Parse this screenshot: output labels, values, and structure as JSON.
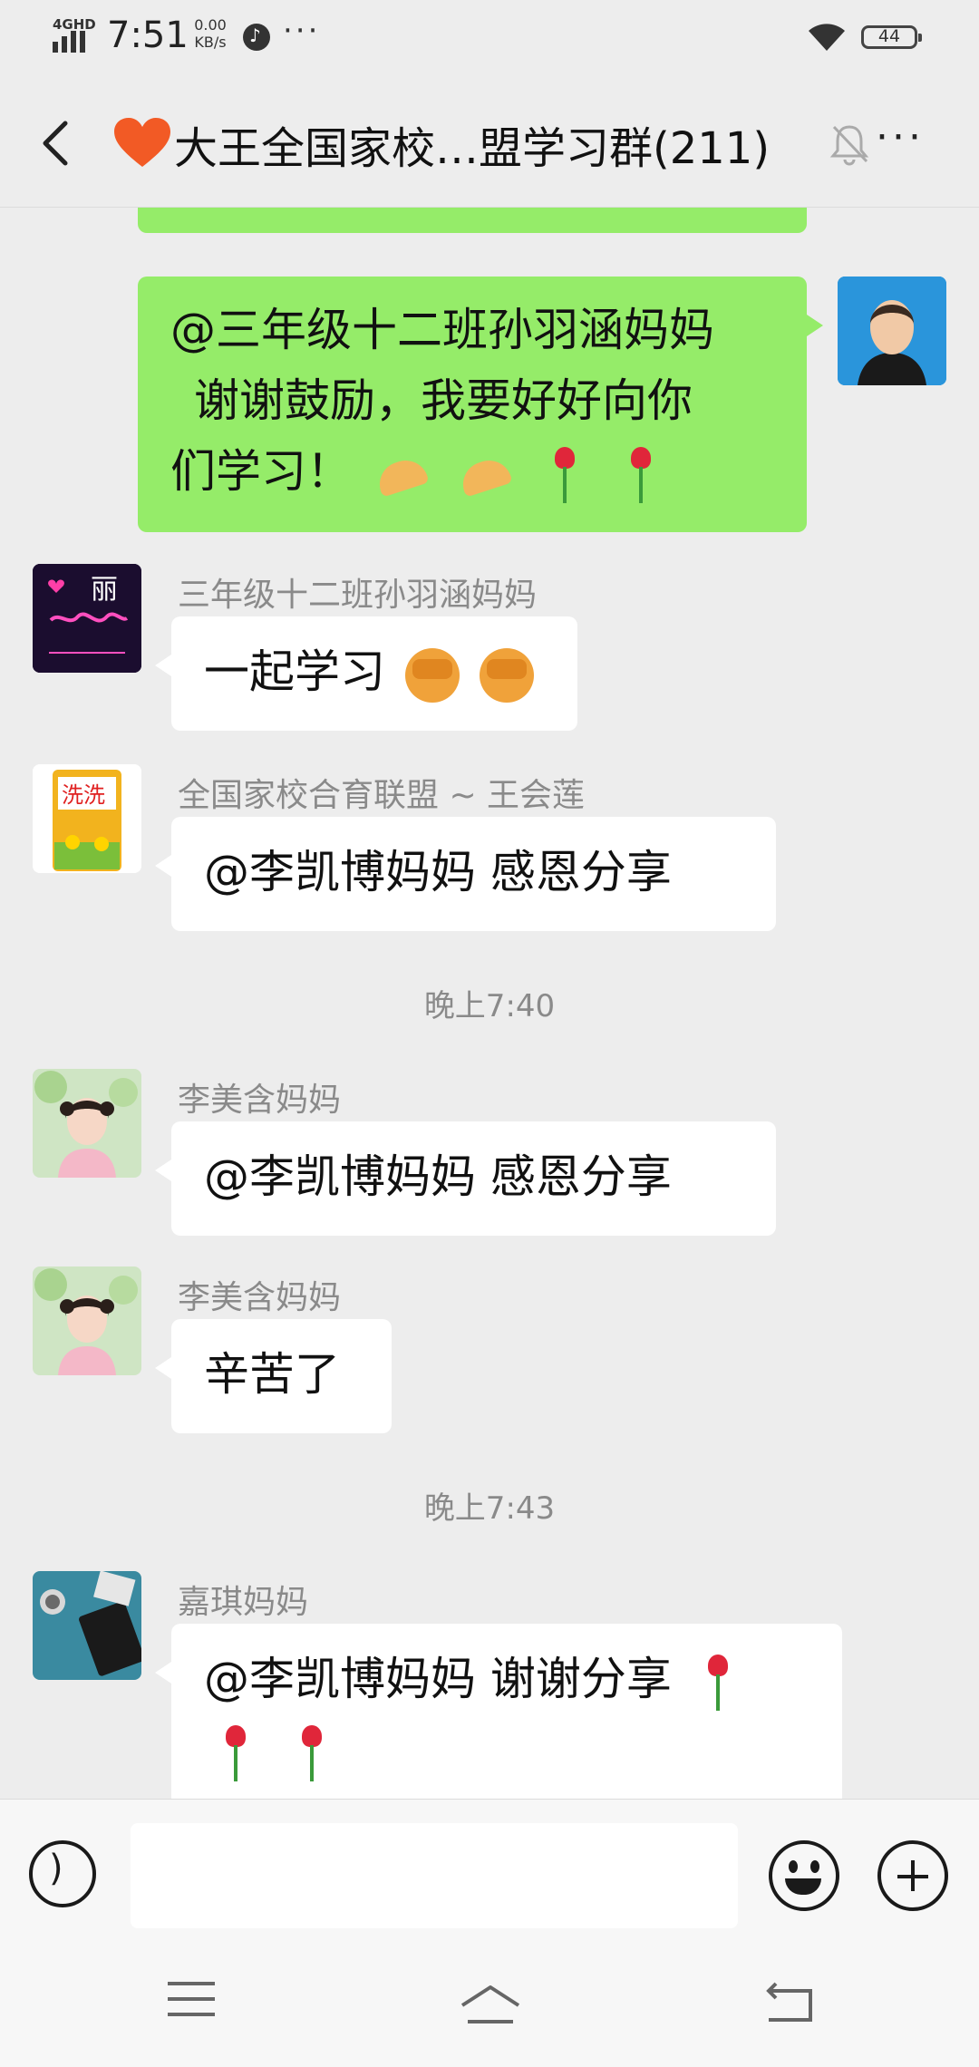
{
  "status_bar": {
    "network_type": "4GHD",
    "time": "7:51",
    "net_speed_value": "0.00",
    "net_speed_unit": "KB/s",
    "more_dots": "···",
    "battery": "44"
  },
  "header": {
    "title": "大王全国家校…盟学习群(211)",
    "more": "···"
  },
  "messages": [
    {
      "type": "partial_top",
      "sender": "me"
    },
    {
      "type": "text",
      "sender": "me",
      "lines": [
        "@三年级十二班孙羽涵妈妈",
        "谢谢鼓励，我要好好向你",
        "们学习！"
      ]
    },
    {
      "type": "text",
      "sender": "三年级十二班孙羽涵妈妈",
      "text": "一起学习"
    },
    {
      "type": "text",
      "sender": "全国家校合育联盟 ~ 王会莲",
      "text": "@李凯博妈妈  感恩分享"
    },
    {
      "type": "time",
      "text": "晚上7:40"
    },
    {
      "type": "text",
      "sender": "李美含妈妈",
      "text": "@李凯博妈妈  感恩分享"
    },
    {
      "type": "text",
      "sender": "李美含妈妈",
      "text": "辛苦了"
    },
    {
      "type": "time",
      "text": "晚上7:43"
    },
    {
      "type": "text",
      "sender": "嘉琪妈妈",
      "text": "@李凯博妈妈  谢谢分享"
    }
  ],
  "avatar_texts": {
    "li_avatar": "丽",
    "bag_avatar": "洗洗"
  },
  "colors": {
    "my_bubble": "#95ec69",
    "other_bubble": "#ffffff",
    "background": "#ededed"
  },
  "icons": [
    "back-arrow-icon",
    "heart-icon",
    "mute-bell-icon",
    "more-icon",
    "voice-icon",
    "emoji-icon",
    "plus-icon",
    "menu-icon",
    "home-icon",
    "back-nav-icon"
  ]
}
